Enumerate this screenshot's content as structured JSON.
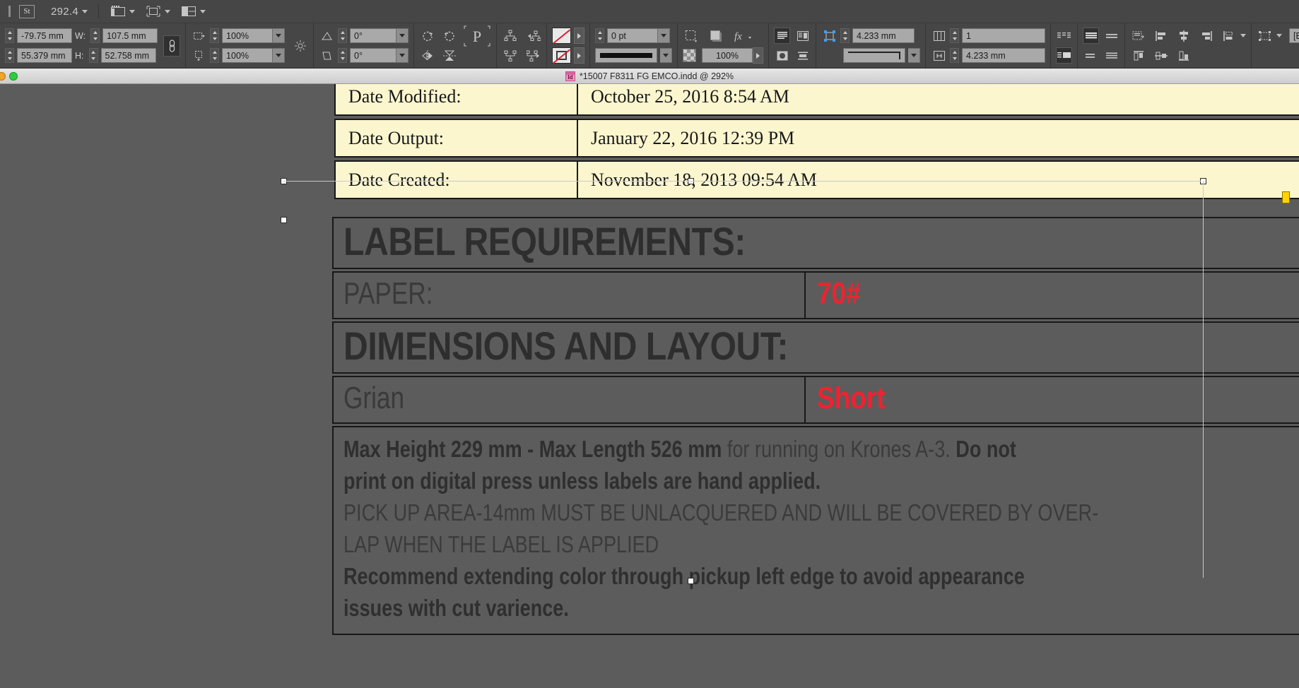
{
  "app": {
    "document_title": "*15007 F8311 FG EMCO.indd @ 292%"
  },
  "control_bar": {
    "style_badge": "St",
    "zoom_level": "292.4",
    "position": {
      "x_label": "",
      "x_value": "-79.75 mm",
      "y_value": "55.379 mm"
    },
    "size": {
      "w_label": "W:",
      "w_value": "107.5 mm",
      "h_label": "H:",
      "h_value": "52.758 mm"
    },
    "scale": {
      "x_value": "100%",
      "y_value": "100%"
    },
    "shear": {
      "rotate_value": "0°",
      "shear_value": "0°"
    },
    "stroke_weight": "0 pt",
    "opacity": "100%",
    "inset_spacing": "4.233 mm",
    "baseline_offset": "4.233 mm",
    "columns_count": "1",
    "gutter": "4.233 mm",
    "object_style": "[Basic Text Frame]"
  },
  "document": {
    "info_rows": [
      {
        "label": "Date Modified:",
        "value": "October 25, 2016 8:54 AM"
      },
      {
        "label": "Date Output:",
        "value": "January 22, 2016 12:39 PM"
      },
      {
        "label": "Date Created:",
        "value": "November 18, 2013 09:54 AM"
      }
    ],
    "requirements": {
      "heading_label": "LABEL REQUIREMENTS:",
      "paper_label": "PAPER:",
      "paper_value": "70#",
      "heading_dimensions": "DIMENSIONS AND LAYOUT:",
      "layout_label": "Grian",
      "layout_value": "Short",
      "notes": [
        {
          "parts": [
            {
              "text": "Max Height 229 mm  - Max Length 526 mm",
              "bold": true
            },
            {
              "text": " for running on Krones A-3. ",
              "bold": false
            },
            {
              "text": " Do not",
              "bold": true
            }
          ]
        },
        {
          "parts": [
            {
              "text": "print on digital press unless labels are hand applied.",
              "bold": true
            }
          ]
        },
        {
          "parts": [
            {
              "text": "PICK UP AREA-14mm MUST BE UNLACQUERED AND WILL BE COVERED BY OVER-",
              "bold": false
            }
          ]
        },
        {
          "parts": [
            {
              "text": "LAP WHEN THE LABEL IS APPLIED",
              "bold": false
            }
          ]
        },
        {
          "parts": [
            {
              "text": "Recommend extending color through pickup left edge to avoid appearance",
              "bold": true
            }
          ]
        },
        {
          "parts": [
            {
              "text": "issues with cut varience.",
              "bold": true
            }
          ]
        }
      ]
    }
  },
  "colors": {
    "accent_red": "#ef2230",
    "paper_cream": "#fbf6ce",
    "canvas_gray": "#5c5c5c",
    "handle_yellow": "#ffd400"
  }
}
